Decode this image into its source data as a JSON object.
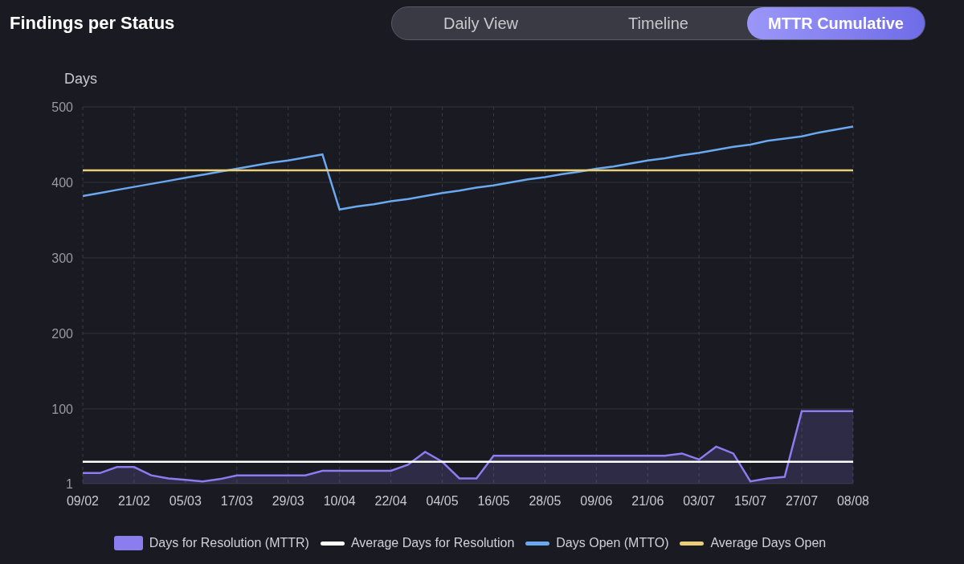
{
  "title": "Findings per Status",
  "view_tabs": [
    {
      "label": "Daily View",
      "selected": false
    },
    {
      "label": "Timeline",
      "selected": false
    },
    {
      "label": "MTTR Cumulative",
      "selected": true
    }
  ],
  "chart": {
    "chart_data": {
      "type": "line",
      "ylabel": "Days",
      "grid": true,
      "categories": [
        "09/02",
        null,
        null,
        "21/02",
        null,
        null,
        "05/03",
        null,
        null,
        "17/03",
        null,
        null,
        "29/03",
        null,
        null,
        "10/04",
        null,
        null,
        "22/04",
        null,
        null,
        "04/05",
        null,
        null,
        "16/05",
        null,
        null,
        "28/05",
        null,
        null,
        "09/06",
        null,
        null,
        "21/06",
        null,
        null,
        "03/07",
        null,
        null,
        "15/07",
        null,
        null,
        "27/07",
        null,
        null,
        "08/08"
      ],
      "ylim": [
        1,
        500
      ],
      "yticks": [
        1,
        100,
        200,
        300,
        400,
        500
      ],
      "series": [
        {
          "name": "Days for Resolution (MTTR)",
          "color": "#8b7cf0",
          "type": "area",
          "values": [
            15,
            15,
            23,
            23,
            12,
            8,
            6,
            4,
            7,
            12,
            12,
            12,
            12,
            12,
            18,
            18,
            18,
            18,
            18,
            26,
            43,
            30,
            8,
            8,
            38,
            38,
            38,
            38,
            38,
            38,
            38,
            38,
            38,
            38,
            38,
            41,
            33,
            50,
            41,
            4,
            8,
            10,
            97,
            97,
            97,
            97
          ]
        },
        {
          "name": "Average Days for Resolution",
          "color": "#ffffff",
          "values": [
            30,
            30,
            30,
            30,
            30,
            30,
            30,
            30,
            30,
            30,
            30,
            30,
            30,
            30,
            30,
            30,
            30,
            30,
            30,
            30,
            30,
            30,
            30,
            30,
            30,
            30,
            30,
            30,
            30,
            30,
            30,
            30,
            30,
            30,
            30,
            30,
            30,
            30,
            30,
            30,
            30,
            30,
            30,
            30,
            30,
            30
          ]
        },
        {
          "name": "Days Open (MTTO)",
          "color": "#6aa8f0",
          "values": [
            382,
            386,
            390,
            394,
            398,
            402,
            406,
            410,
            414,
            418,
            422,
            426,
            429,
            433,
            437,
            364,
            368,
            371,
            375,
            378,
            382,
            386,
            389,
            393,
            396,
            400,
            404,
            407,
            411,
            414,
            418,
            421,
            425,
            429,
            432,
            436,
            439,
            443,
            447,
            450,
            455,
            458,
            461,
            466,
            470,
            474
          ]
        },
        {
          "name": "Average Days Open",
          "color": "#e8cf78",
          "values": [
            416,
            416,
            416,
            416,
            416,
            416,
            416,
            416,
            416,
            416,
            416,
            416,
            416,
            416,
            416,
            416,
            416,
            416,
            416,
            416,
            416,
            416,
            416,
            416,
            416,
            416,
            416,
            416,
            416,
            416,
            416,
            416,
            416,
            416,
            416,
            416,
            416,
            416,
            416,
            416,
            416,
            416,
            416,
            416,
            416,
            416
          ]
        }
      ]
    }
  }
}
